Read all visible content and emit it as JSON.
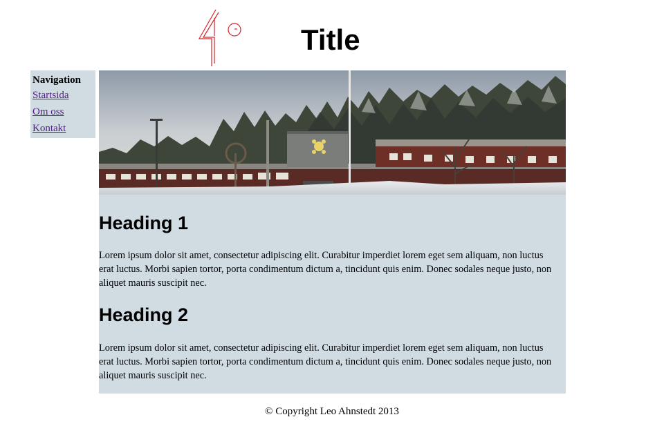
{
  "header": {
    "title": "Title",
    "logo_icon": "red-line-logo-icon"
  },
  "navigation": {
    "heading": "Navigation",
    "links": [
      {
        "label": "Startsida"
      },
      {
        "label": "Om oss"
      },
      {
        "label": "Kontakt"
      }
    ],
    "link_color": "#551a8b",
    "background": "#d1dbe2"
  },
  "main": {
    "banner_icon": "school-building-winter-photo",
    "sections": [
      {
        "heading": "Heading 1",
        "body": "Lorem ipsum dolor sit amet, consectetur adipiscing elit. Curabitur imperdiet lorem eget sem aliquam, non luctus erat luctus. Morbi sapien tortor, porta condimentum dictum a, tincidunt quis enim. Donec sodales neque justo, non aliquet mauris suscipit nec."
      },
      {
        "heading": "Heading 2",
        "body": "Lorem ipsum dolor sit amet, consectetur adipiscing elit. Curabitur imperdiet lorem eget sem aliquam, non luctus erat luctus. Morbi sapien tortor, porta condimentum dictum a, tincidunt quis enim. Donec sodales neque justo, non aliquet mauris suscipit nec."
      }
    ]
  },
  "footer": {
    "copyright": "© Copyright Leo Ahnstedt 2013"
  }
}
